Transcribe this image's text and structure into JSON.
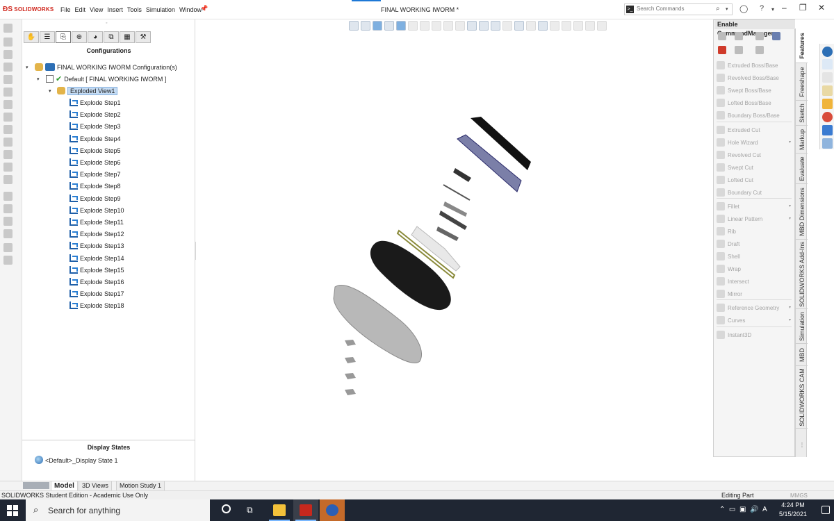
{
  "app": {
    "logo": "SOLIDWORKS",
    "menu": [
      "File",
      "Edit",
      "View",
      "Insert",
      "Tools",
      "Simulation",
      "Window"
    ],
    "document_title": "FINAL WORKING IWORM *",
    "search_placeholder": "Search Commands"
  },
  "feature_manager": {
    "configurations_header": "Configurations",
    "root": "FINAL WORKING IWORM Configuration(s)",
    "default_config": "Default [ FINAL WORKING IWORM ]",
    "exploded_view": "Exploded View1",
    "steps": [
      "Explode Step1",
      "Explode Step2",
      "Explode Step3",
      "Explode Step4",
      "Explode Step5",
      "Explode Step6",
      "Explode Step7",
      "Explode Step8",
      "Explode Step9",
      "Explode Step10",
      "Explode Step11",
      "Explode Step12",
      "Explode Step13",
      "Explode Step14",
      "Explode Step15",
      "Explode Step16",
      "Explode Step17",
      "Explode Step18"
    ],
    "display_states_header": "Display States",
    "display_state": "<Default>_Display State 1"
  },
  "command_manager": {
    "title": "Enable CommandManager",
    "items": [
      "Extruded Boss/Base",
      "Revolved Boss/Base",
      "Swept Boss/Base",
      "Lofted Boss/Base",
      "Boundary Boss/Base",
      "Extruded Cut",
      "Hole Wizard",
      "Revolved Cut",
      "Swept Cut",
      "Lofted Cut",
      "Boundary Cut",
      "Fillet",
      "Linear Pattern",
      "Rib",
      "Draft",
      "Shell",
      "Wrap",
      "Intersect",
      "Mirror",
      "Reference Geometry",
      "Curves",
      "Instant3D"
    ],
    "tabs": [
      "Features",
      "Freeshape",
      "Sketch",
      "Markup",
      "Evaluate",
      "MBD Dimensions",
      "SOLIDWORKS Add-Ins",
      "Simulation",
      "MBD",
      "SOLIDWORKS CAM"
    ],
    "more": "⋮"
  },
  "bottom_tabs": [
    "Model",
    "3D Views",
    "Motion Study 1"
  ],
  "status": {
    "left": "SOLIDWORKS Student Edition - Academic Use Only",
    "mode": "Editing Part",
    "units": "MMGS"
  },
  "taskbar": {
    "search": "Search for anything",
    "time": "4:24 PM",
    "date": "5/15/2021"
  },
  "colors": {
    "brand": "#d0271d",
    "selection": "#c5dcf4",
    "taskbar": "#1f2633",
    "step_icon": "#1e5fa8"
  }
}
